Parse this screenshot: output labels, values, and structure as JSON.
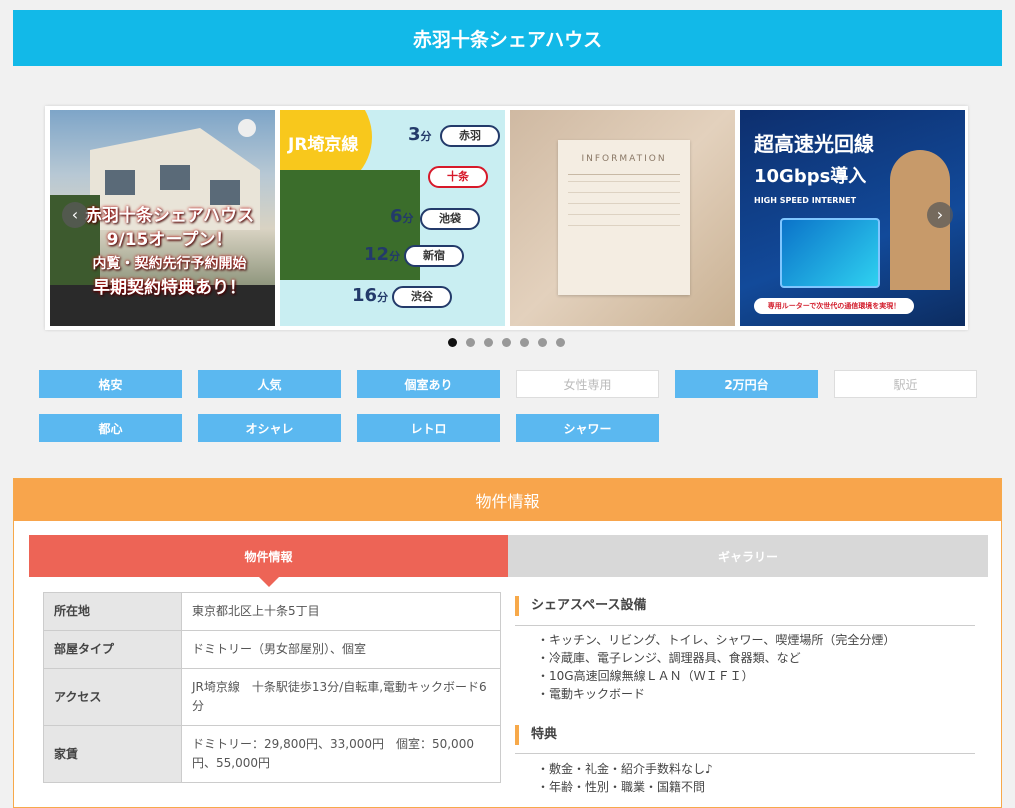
{
  "header": {
    "title": "赤羽十条シェアハウス"
  },
  "carousel": {
    "slide1": {
      "lines": [
        "赤羽十条シェアハウス",
        "9/15オープン！",
        "内覧・契約先行予約開始",
        "早期契約特典あり！"
      ]
    },
    "slide2": {
      "line": "JR埼京線",
      "stations": [
        {
          "min": "3",
          "unit": "分",
          "name": "赤羽"
        },
        {
          "min": "",
          "unit": "",
          "name": "十条"
        },
        {
          "min": "6",
          "unit": "分",
          "name": "池袋"
        },
        {
          "min": "12",
          "unit": "分",
          "name": "新宿"
        },
        {
          "min": "16",
          "unit": "分",
          "name": "渋谷"
        }
      ]
    },
    "slide3": {
      "heading": "Information"
    },
    "slide4": {
      "line1": "超高速光回線",
      "line2": "10Gbps導入",
      "line3": "HIGH SPEED INTERNET",
      "footer": "専用ルーターで次世代の通信環境を実現！"
    },
    "dots": 7,
    "active_dot": 0,
    "prev_icon": "chevron-left-icon",
    "next_icon": "chevron-right-icon"
  },
  "tags": [
    {
      "label": "格安",
      "active": true
    },
    {
      "label": "人気",
      "active": true
    },
    {
      "label": "個室あり",
      "active": true
    },
    {
      "label": "女性専用",
      "active": false
    },
    {
      "label": "2万円台",
      "active": true
    },
    {
      "label": "駅近",
      "active": false
    },
    {
      "label": "都心",
      "active": true
    },
    {
      "label": "オシャレ",
      "active": true
    },
    {
      "label": "レトロ",
      "active": true
    },
    {
      "label": "シャワー",
      "active": true
    }
  ],
  "property": {
    "heading": "物件情報",
    "tabs": {
      "info": "物件情報",
      "gallery": "ギャラリー"
    },
    "rows": [
      {
        "key": "所在地",
        "value": "東京都北区上十条5丁目"
      },
      {
        "key": "部屋タイプ",
        "value": "ドミトリー（男女部屋別）、個室"
      },
      {
        "key": "アクセス",
        "value": "JR埼京線　十条駅徒歩13分/自転車,電動キックボード6分"
      },
      {
        "key": "家賃",
        "value": "ドミトリー：29,800円、33,000円　個室：50,000円、55,000円"
      }
    ],
    "facilities": {
      "title": "シェアスペース設備",
      "items": [
        "キッチン、リビング、トイレ、シャワー、喫煙場所（完全分煙）",
        "冷蔵庫、電子レンジ、調理器具、食器類、など",
        "10G高速回線無線ＬＡＮ（ＷＩＦＩ）",
        "電動キックボード"
      ]
    },
    "benefits": {
      "title": "特典",
      "items": [
        "敷金・礼金・紹介手数料なし♪",
        "年齢・性別・職業・国籍不問"
      ]
    }
  },
  "colors": {
    "header": "#12b9e8",
    "tag": "#5bb8f0",
    "panel": "#f8a54c",
    "tab_active": "#ed6456"
  }
}
